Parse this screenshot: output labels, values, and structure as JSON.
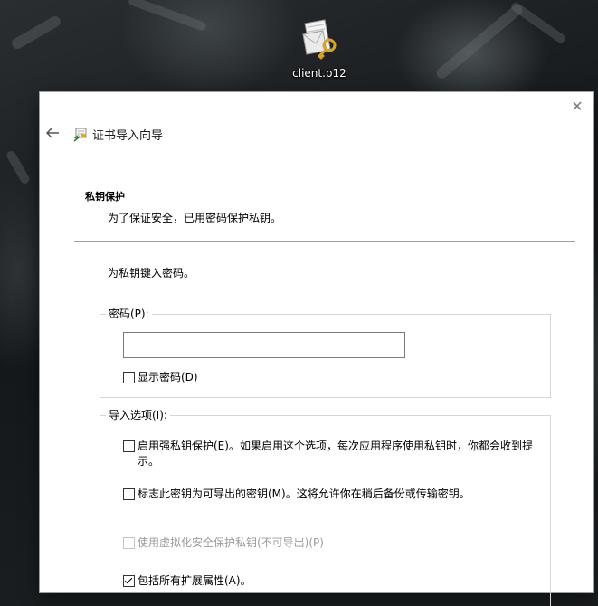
{
  "desktop": {
    "icon_label": "client.p12"
  },
  "wizard": {
    "title": "证书导入向导",
    "section_title": "私钥保护",
    "section_desc": "为了保证安全，已用密码保护私钥。",
    "prompt": "为私钥键入密码。"
  },
  "password_group": {
    "legend": "密码(P):",
    "value": "",
    "show_password": {
      "label": "显示密码(D)",
      "checked": false
    }
  },
  "options_group": {
    "legend": "导入选项(I):",
    "strong_protection": {
      "label": "启用强私钥保护(E)。如果启用这个选项，每次应用程序使用私钥时，你都会收到提示。",
      "checked": false
    },
    "exportable": {
      "label": "标志此密钥为可导出的密钥(M)。这将允许你在稍后备份或传输密钥。",
      "checked": false
    },
    "virtualization": {
      "label": "使用虚拟化安全保护私钥(不可导出)(P)",
      "checked": false,
      "disabled": true
    },
    "extended_props": {
      "label": "包括所有扩展属性(A)。",
      "checked": true
    }
  },
  "icons": {
    "close": "close-icon",
    "back": "back-arrow-icon",
    "wizard": "certificate-wizard-icon",
    "file": "certificate-file-icon"
  }
}
